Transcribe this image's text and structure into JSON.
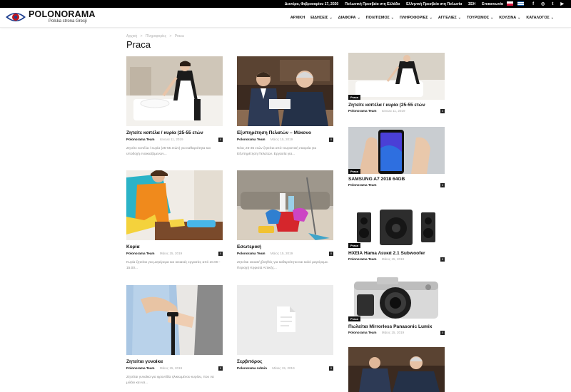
{
  "topbar": {
    "links": [
      "Δευτέρα, Φεβρουαρίου 17, 2020",
      "Πολωνική Πρεσβεία στη Ελλάδα",
      "Ελληνική Πρεσβεία στη Πολωνία",
      "ΣΕΗ",
      "Επικοινωνία"
    ],
    "social": [
      "f",
      "◎",
      "t",
      "▶"
    ]
  },
  "logo": {
    "name": "POLONORAMA",
    "tagline": "Polska strona Grecji"
  },
  "nav": [
    {
      "label": "ΑΡΧΙΚΗ",
      "dropdown": false
    },
    {
      "label": "ΕΙΔΗΣΕΙΣ",
      "dropdown": true
    },
    {
      "label": "ΔΙΑΦΟΡΑ",
      "dropdown": true
    },
    {
      "label": "ΠΟΛΙΤΙΣΜΟΣ",
      "dropdown": true
    },
    {
      "label": "ΠΛΗΡΟΦΟΡΙΕΣ",
      "dropdown": true
    },
    {
      "label": "ΑΓΓΕΛΙΕΣ",
      "dropdown": true
    },
    {
      "label": "ΤΟΥΡΙΣΜΟΣ",
      "dropdown": true
    },
    {
      "label": "ΚΟΥΖΙΝΑ",
      "dropdown": true
    },
    {
      "label": "ΚΑΤΑΛΟΓΟΣ",
      "dropdown": true
    }
  ],
  "breadcrumb": [
    "Αρχική",
    ">",
    "Πληροφορίες",
    ">",
    "Praca"
  ],
  "page_title": "Praca",
  "posts": [
    {
      "title": "Ζητείτε κοπέλα / κυρία (25-55 ετών",
      "author": "Polonorama Team",
      "date": "Ιανουα 11, 2019",
      "count": "0",
      "excerpt": "Ζητείτε κοπέλα / κυρία (25-55 ετών) για καθαριότητα και υποδοχή ενοικιαζόμενων..."
    },
    {
      "title": "Εξυπηρέτηση Πελατών – Μύκονο",
      "author": "Polonorama Team",
      "date": "Μάιος 15, 2019",
      "count": "0",
      "excerpt": "Νέος 25-35 ετών ζητείται από τουριστική εταιρεία για Εξυπηρέτηση Πελατών. Εργασία για..."
    },
    {
      "title": "Κυρία",
      "author": "Polonorama Team",
      "date": "Μάιος 15, 2019",
      "count": "0",
      "excerpt": "Κυρία ζητείται για μαγείρεμα και οικιακές εργασίες από 10.00 - 15.00..."
    },
    {
      "title": "Εσωτερική",
      "author": "Polonorama Team",
      "date": "Μάιος 15, 2019",
      "count": "0",
      "excerpt": "Ζητείται οικιακή βοηθός για καθαριότητα και καλό μαγείρεμα. Περιοχή Κηφισιά Αττικής..."
    },
    {
      "title": "Ζητείται γυναίκα",
      "author": "Polonorama Team",
      "date": "Μάιος 15, 2019",
      "count": "0",
      "excerpt": "Ζητείται γυναίκα για φροντίδα ηλικιωμένου κυρίου, που να μιλάει και να..."
    },
    {
      "title": "Σερβιτόρος",
      "author": "Polonorama Admin",
      "date": "Μάιος 15, 2019",
      "count": "0",
      "excerpt": ""
    }
  ],
  "sidebar": [
    {
      "title": "Ζητείτε κοπέλα / κυρία (25-55 ετών",
      "category": "Praca",
      "author": "Polonorama Team",
      "date": "Ιανουα 11, 2019",
      "count": "0"
    },
    {
      "title": "SAMSUNG A7 2018 64GB",
      "category": "Praca",
      "author": "Polonorama Team",
      "date": "",
      "count": "0"
    },
    {
      "title": "ΗΧΕΙΑ Hama Λευκά 2.1 Subwoofer",
      "category": "Praca",
      "author": "Polonorama Team",
      "date": "Μάιος 15, 2019",
      "count": "0"
    },
    {
      "title": "Πωλείται Mirrorless Panasonic Lumix",
      "category": "Praca",
      "author": "Polonorama Team",
      "date": "Μάιος 15, 2019",
      "count": "0"
    },
    {
      "title": "",
      "category": "",
      "author": "",
      "date": "",
      "count": ""
    }
  ],
  "colors": {
    "topbar": "#000000",
    "accent": "#c0161f",
    "text": "#111111",
    "muted": "#a5a5a5"
  }
}
